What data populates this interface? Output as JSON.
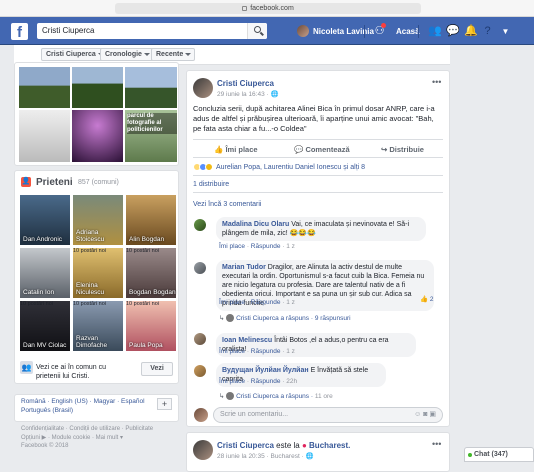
{
  "browser": {
    "url": "facebook.com"
  },
  "topbar": {
    "search_value": "Cristi Ciuperca",
    "user_name": "Nicoleta Lavinia",
    "home": "Acasă"
  },
  "profile_nav": {
    "name": "Cristi Ciuperca",
    "timeline": "Cronologie",
    "recent": "Recente"
  },
  "friends": {
    "title": "Prieteni",
    "count": "857 (comuni)",
    "items": [
      {
        "name": "Dan Andronic",
        "sub": ""
      },
      {
        "name": "Adriana Stoicescu",
        "sub": ""
      },
      {
        "name": "Alin Bogdan",
        "sub": ""
      },
      {
        "name": "Catalin Ion",
        "sub": ""
      },
      {
        "name": "Elenina Niculescu",
        "sub": "10 postări noi"
      },
      {
        "name": "Bogdan Bogdan",
        "sub": "10 postări noi"
      },
      {
        "name": "Dan MV Ciolac",
        "sub": "10 postări noi"
      },
      {
        "name": "Razvan Dimofache",
        "sub": "10 postări noi"
      },
      {
        "name": "Paula Popa",
        "sub": "10 postări noi"
      }
    ],
    "prompt": "Vezi ce ai în comun cu prietenii lui Cristi.",
    "button": "Vezi"
  },
  "photo_caption": "parcul de fotografie al politicienilor",
  "languages": {
    "line1": "Română · English (US) · Magyar · Español",
    "line2": "Português (Brasil)",
    "add": "+"
  },
  "footer": {
    "line1": "Confidențialitate · Condiții de utilizare · Publicitate",
    "line2": "Opțiuni ▶ · Module cookie · Mai mult ▾",
    "line3": "Facebook © 2018"
  },
  "post": {
    "author": "Cristi Ciuperca",
    "date": "29 iunie la 16:43 · 🌐",
    "text": "Concluzia serii, după achitarea Alinei Bica în primul dosar ANRP, care i-a adus de altfel și prăbușirea ulterioară, îi aparține unui amic avocat: \"Bah, pe fata asta chiar a fu...-o Coldea\"",
    "like": "Îmi place",
    "comment": "Comentează",
    "share": "Distribuie",
    "reactions": "Aurelian Popa, Laurentiu Daniel Ionescu și alți 8",
    "shares": "1 distribuire",
    "more_comments": "Vezi încă 3 comentarii"
  },
  "comments": [
    {
      "author": "Madalina Dicu Olaru",
      "text": "Vai, ce imaculata și nevinovata e! Să-i plângem de mila, zic! 😂😂😂",
      "like": "Îmi place",
      "reply": "Răspunde",
      "time": "1 z"
    },
    {
      "author": "Marian Tudor",
      "text": "Dragilor, are Alinuta la activ destul de multe executari la ordin. Oportunismul s-a facut cuib la Bica. Femeia nu are nicio legatura cu profesia. Dare are talentul nativ de a fi obedienta oricui. Important e sa puna un șir sub cur. Adica sa prinda functie.",
      "like": "Îmi place",
      "reply": "Răspunde",
      "time": "1 z",
      "count": "2",
      "reply_note": "Cristi Ciuperca a răspuns · ",
      "reply_count": "9 răspunsuri"
    },
    {
      "author": "Ioan Melinescu",
      "text": "Întâi Botos ,el a adus,o pentru ca era oralista!",
      "like": "Îmi place",
      "reply": "Răspunde",
      "time": "1 z"
    },
    {
      "author": "Вудущан Йулйан Йулйан",
      "text": "E învățată să stele caprita",
      "like": "Îmi place",
      "reply": "Răspunde",
      "time": "22h",
      "reply_note": "Cristi Ciuperca a răspuns · ",
      "reply_count": "11 ore"
    }
  ],
  "write_comment": "Scrie un comentariu...",
  "post2": {
    "author": "Cristi Ciuperca",
    "location_prefix": "este la",
    "location": "Bucharest.",
    "date": "28 iunie la 20:35 · Bucharest · 🌐"
  },
  "chat": {
    "label": "Chat (347)"
  },
  "colors": {
    "brand": "#4267b2",
    "link": "#385898",
    "background": "#e9ebee"
  }
}
